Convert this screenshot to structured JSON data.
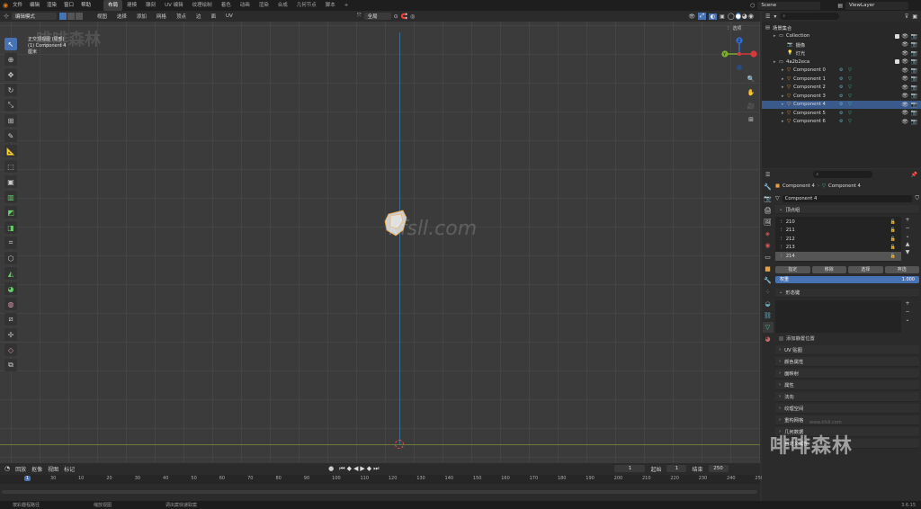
{
  "menu": {
    "items": [
      "文件",
      "编辑",
      "渲染",
      "窗口",
      "帮助"
    ]
  },
  "workspaces": {
    "items": [
      "布局",
      "建模",
      "雕刻",
      "UV 编辑",
      "纹理绘制",
      "着色",
      "动画",
      "渲染",
      "合成",
      "几何节点",
      "脚本"
    ],
    "active": 0,
    "add": "+"
  },
  "top_right": {
    "scene": "Scene",
    "view_layer": "ViewLayer"
  },
  "viewport_header": {
    "mode": "编辑模式",
    "menus": [
      "视图",
      "选择",
      "添加",
      "网格",
      "顶点",
      "边",
      "面",
      "UV"
    ],
    "transform_orientation": "全局",
    "options": "选项"
  },
  "overlay_text": {
    "line1": "正交顶视图 (局部)",
    "line2": "(1) Component 4",
    "line3": "厘米"
  },
  "watermark": {
    "top": "啡啡森林",
    "center": "kfsll.com",
    "bottom_small": "www.kfsll.com",
    "bottom_big": "啡啡森林"
  },
  "gizmo": {
    "x": "X",
    "y": "Y",
    "z": "Z"
  },
  "timeline": {
    "menus": [
      "回放",
      "抠像",
      "视图",
      "标记"
    ],
    "current_frame": "1",
    "start_label": "起始",
    "start": "1",
    "end_label": "结束",
    "end": "250",
    "ticks": [
      "1",
      "30",
      "10",
      "20",
      "30",
      "40",
      "50",
      "60",
      "70",
      "80",
      "90",
      "100",
      "110",
      "120",
      "130",
      "140",
      "150",
      "160",
      "170",
      "180",
      "190",
      "200",
      "210",
      "220",
      "230",
      "240",
      "250"
    ]
  },
  "statusbar": {
    "items": [
      "按彩趣程路径",
      "缩放视图",
      "调出案快速取案"
    ],
    "version": "3.6.15"
  },
  "outliner": {
    "search_placeholder": "",
    "root": "场景集合",
    "rows": [
      {
        "label": "Collection",
        "indent": 1,
        "type": "collection",
        "selected": false
      },
      {
        "label": "摄像",
        "indent": 2,
        "type": "camera",
        "selected": false
      },
      {
        "label": "灯光",
        "indent": 2,
        "type": "light",
        "selected": false
      },
      {
        "label": "4a2b2eca",
        "indent": 1,
        "type": "collection",
        "selected": false
      },
      {
        "label": "Component 0",
        "indent": 2,
        "type": "mesh",
        "selected": false
      },
      {
        "label": "Component 1",
        "indent": 2,
        "type": "mesh",
        "selected": false
      },
      {
        "label": "Component 2",
        "indent": 2,
        "type": "mesh",
        "selected": false
      },
      {
        "label": "Component 3",
        "indent": 2,
        "type": "mesh",
        "selected": false
      },
      {
        "label": "Component 4",
        "indent": 2,
        "type": "mesh",
        "selected": true
      },
      {
        "label": "Component 5",
        "indent": 2,
        "type": "mesh",
        "selected": false
      },
      {
        "label": "Component 6",
        "indent": 2,
        "type": "mesh",
        "selected": false
      }
    ]
  },
  "properties": {
    "breadcrumb_object": "Component 4",
    "breadcrumb_mesh": "Component 4",
    "mesh_name": "Component 4",
    "vertex_groups_title": "顶点组",
    "vertex_groups": [
      "210",
      "211",
      "212",
      "213",
      "214"
    ],
    "active_group": 4,
    "buttons": [
      "指定",
      "移除",
      "选择",
      "弃选"
    ],
    "weight_label": "权重",
    "weight_value": "1.000",
    "shape_keys_title": "形态键",
    "relative_label": "添加静置位置",
    "sections": [
      "UV 贴图",
      "颜色属性",
      "面映射",
      "属性",
      "法向",
      "纹理空间",
      "重构网格",
      "几何数据",
      "自定义属性"
    ]
  },
  "colors": {
    "accent": "#4772b3",
    "selected_row": "#3a5a8c",
    "axis_y": "#3c6d8f",
    "axis_x": "#6e7a3b",
    "mesh_orange": "#e8a040"
  }
}
